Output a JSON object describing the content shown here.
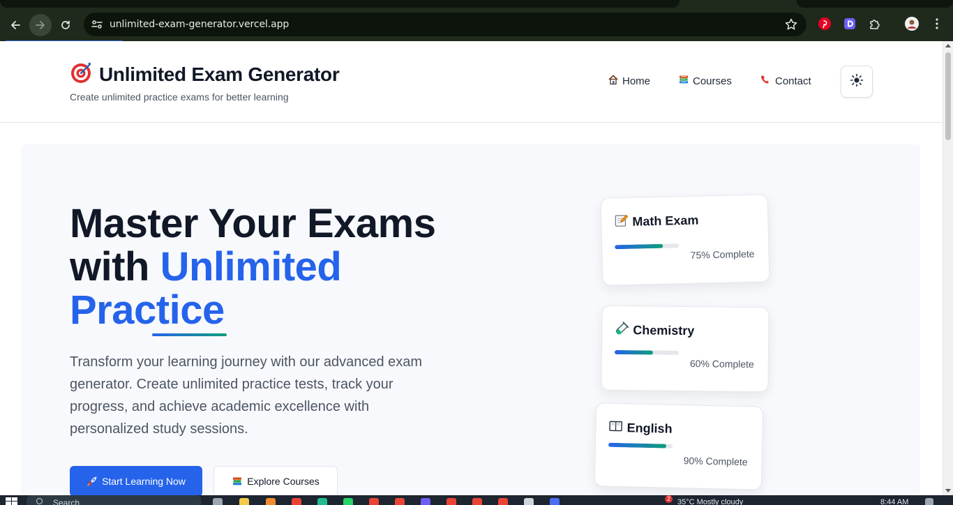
{
  "browser": {
    "url": "unlimited-exam-generator.vercel.app",
    "extensions": [
      "pinterest-icon",
      "d-extension-icon",
      "puzzle-icon"
    ],
    "accent": "#2f6bde"
  },
  "header": {
    "title": "Unlimited Exam Generator",
    "subtitle": "Create unlimited practice exams for better learning",
    "nav": [
      {
        "label": "Home",
        "icon": "house-icon"
      },
      {
        "label": "Courses",
        "icon": "books-icon"
      },
      {
        "label": "Contact",
        "icon": "telephone-icon"
      }
    ],
    "theme_toggle_icon": "sun-icon"
  },
  "hero": {
    "title_line1": "Master Your Exams",
    "title_line2_prefix": "with ",
    "title_line2_accent": "Unlimited",
    "title_line3_accent": "Practice",
    "description": "Transform your learning journey with our advanced exam generator. Create unlimited practice tests, track your progress, and achieve academic excellence with personalized study sessions.",
    "primary_cta": "Start Learning Now",
    "secondary_cta": "Explore Courses",
    "accent_color": "#2563eb"
  },
  "cards": [
    {
      "title": "Math Exam",
      "icon": "memo-icon",
      "progress": 0.75,
      "progress_label": "75% Complete"
    },
    {
      "title": "Chemistry",
      "icon": "test-tube-icon",
      "progress": 0.6,
      "progress_label": "60% Complete"
    },
    {
      "title": "English",
      "icon": "open-book-icon",
      "progress": 0.9,
      "progress_label": "90% Complete"
    }
  ],
  "taskbar": {
    "search_label": "Search",
    "notification_count": "2",
    "weather": "35°C  Mostly cloudy",
    "time": "8:44 AM"
  }
}
